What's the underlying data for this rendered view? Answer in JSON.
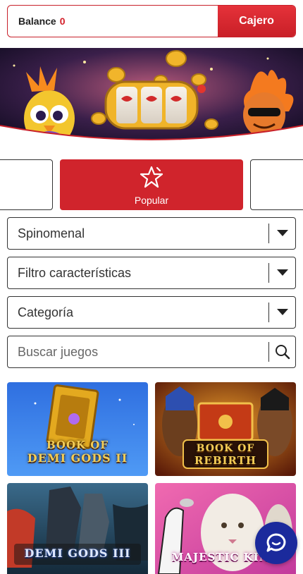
{
  "header": {
    "balance_label": "Balance",
    "balance_value": "0",
    "cashier_label": "Cajero"
  },
  "tabs": {
    "active_label": "Popular"
  },
  "filters": {
    "provider": "Spinomenal",
    "features": "Filtro características",
    "category": "Categoría",
    "search_placeholder": "Buscar juegos"
  },
  "games": [
    {
      "title_line1": "BOOK OF",
      "title_line2": "DEMI GODS II"
    },
    {
      "title_line1": "BOOK OF",
      "title_line2": "REBIRTH"
    },
    {
      "title_line1": "DEMI GODS III",
      "title_line2": ""
    },
    {
      "title_line1": "MAJESTIC KING",
      "title_line2": ""
    }
  ],
  "colors": {
    "brand_red": "#d0242c",
    "chat_blue": "#1b2a9c"
  },
  "icons": {
    "tab": "star-icon",
    "dropdown": "chevron-down-icon",
    "search": "search-icon",
    "chat": "chat-icon"
  }
}
